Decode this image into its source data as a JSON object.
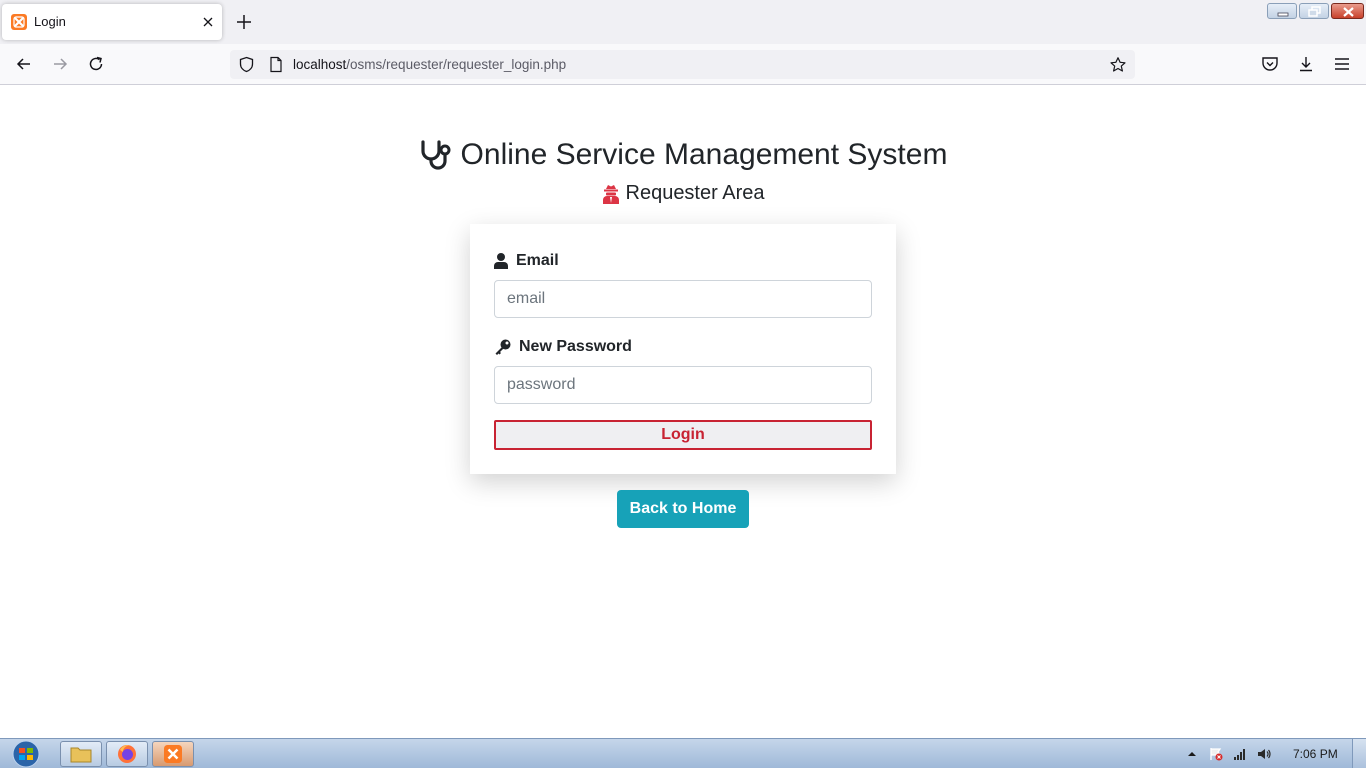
{
  "browser": {
    "tab_title": "Login",
    "url_host": "localhost",
    "url_path": "/osms/requester/requester_login.php"
  },
  "page": {
    "title": "Online Service Management System",
    "subtitle": "Requester Area",
    "form": {
      "email_label": "Email",
      "email_placeholder": "email",
      "email_value": "",
      "password_label": "New Password",
      "password_placeholder": "password",
      "password_value": "",
      "login_label": "Login"
    },
    "back_home_label": "Back to Home"
  },
  "taskbar": {
    "clock": "7:06 PM"
  },
  "colors": {
    "danger": "#c82333",
    "info": "#17a2b8",
    "text": "#212529"
  }
}
